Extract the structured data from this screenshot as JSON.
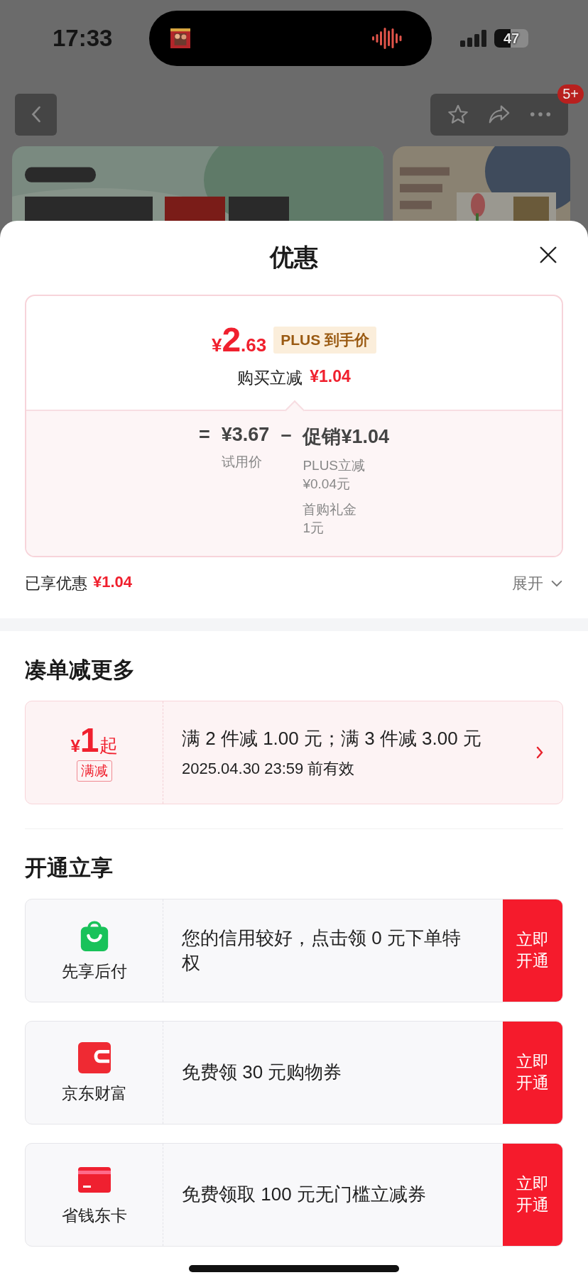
{
  "status_bar": {
    "time": "17:33",
    "battery": "47"
  },
  "top_nav": {
    "more_badge": "5+"
  },
  "sheet": {
    "title": "优惠",
    "price_card": {
      "currency": "¥",
      "price_integer": "2",
      "price_decimal": ".63",
      "tag": "PLUS 到手价",
      "instant_label": "购买立减",
      "instant_amount": "¥1.04",
      "equals": "=",
      "base_price": "¥3.67",
      "minus": "–",
      "promo_label": "促销",
      "promo_amount": "¥1.04",
      "base_caption": "试用价",
      "details": [
        {
          "name": "PLUS立减",
          "amount": "¥0.04元"
        },
        {
          "name": "首购礼金",
          "amount": "1元"
        }
      ]
    },
    "enjoyed": {
      "label": "已享优惠",
      "amount": "¥1.04",
      "expand": "展开",
      "expanded": false
    },
    "bundle_section": {
      "title": "凑单减更多",
      "coupon": {
        "currency": "¥",
        "amount": "1",
        "suffix": "起",
        "tag": "满减",
        "rule": "满 2 件减 1.00 元；满 3 件减 3.00 元",
        "validity": "2025.04.30 23:59 前有效"
      }
    },
    "open_section": {
      "title": "开通立享",
      "items": [
        {
          "kind": "bag",
          "name": "先享后付",
          "text": "您的信用较好，点击领 0 元下单特权",
          "button": "立即开通"
        },
        {
          "kind": "wallet",
          "name": "京东财富",
          "text": "免费领 30 元购物券",
          "button": "立即开通"
        },
        {
          "kind": "card",
          "name": "省钱东卡",
          "text": "免费领取 100 元无门槛立减券",
          "button": "立即开通"
        }
      ]
    }
  }
}
